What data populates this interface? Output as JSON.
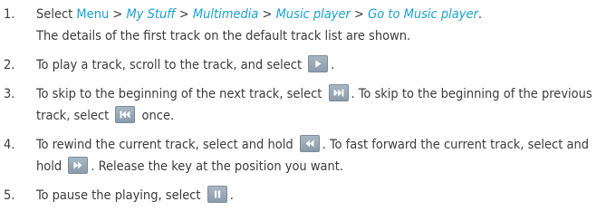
{
  "steps": [
    {
      "num": "1.",
      "t1": "Select ",
      "menu": "Menu",
      "sep1": " > ",
      "p1": "My Stuff",
      "sep2": " > ",
      "p2": "Multimedia",
      "sep3": " > ",
      "p3": "Music player",
      "sep4": " > ",
      "p4": "Go to Music player",
      "end": ".",
      "line2": "The details of the first track on the default track list are shown."
    },
    {
      "num": "2.",
      "t1": "To play a track, scroll to the track, and select ",
      "end": "."
    },
    {
      "num": "3.",
      "t1": "To skip to the beginning of the next track, select ",
      "t2": ". To skip to the beginning of the previous track, select ",
      "t3": " once."
    },
    {
      "num": "4.",
      "t1": "To rewind the current track, select and hold ",
      "t2": ". To fast forward the current track, select and hold ",
      "t3": ". Release the key at the position you want."
    },
    {
      "num": "5.",
      "t1": "To pause the playing, select ",
      "end": "."
    }
  ],
  "icons": {
    "play": "play-icon",
    "next": "skip-next-icon",
    "previous": "skip-previous-icon",
    "rewind": "rewind-icon",
    "forward": "fast-forward-icon",
    "pause": "pause-icon"
  }
}
